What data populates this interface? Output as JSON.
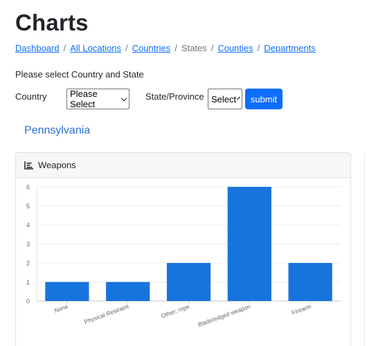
{
  "page": {
    "title": "Charts"
  },
  "breadcrumb": {
    "items": [
      {
        "label": "Dashboard",
        "link": true
      },
      {
        "label": "All Locations",
        "link": true
      },
      {
        "label": "Countries",
        "link": true
      },
      {
        "label": "States",
        "link": false
      },
      {
        "label": "Counties",
        "link": true
      },
      {
        "label": "Departments",
        "link": true
      }
    ],
    "separator": "/"
  },
  "form": {
    "prompt": "Please select Country and State",
    "country_label": "Country",
    "country_value": "Please Select",
    "state_label": "State/Province",
    "state_value": "Select",
    "submit_label": "submit"
  },
  "region": {
    "name": "Pennsylvania"
  },
  "card": {
    "header_label": "Weapons",
    "header_icon": "bar-chart-icon"
  },
  "colors": {
    "accent": "#0d6efd",
    "bar": "#1874dd",
    "region_title": "#2c6fd1"
  },
  "chart_data": {
    "type": "bar",
    "categories": [
      "None",
      "Physical Restraint",
      "Other: rope",
      "Blade/edged weapon",
      "Firearm"
    ],
    "values": [
      1,
      1,
      2,
      6,
      2
    ],
    "yticks": [
      0,
      1,
      2,
      3,
      4,
      5,
      6
    ],
    "ylim": [
      0,
      6
    ],
    "grid": true,
    "legend": "none"
  }
}
